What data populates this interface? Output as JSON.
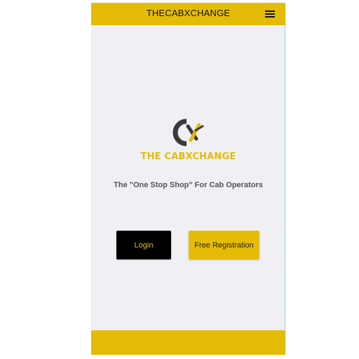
{
  "header": {
    "title": "THECABXCHANGE",
    "menu_icon": "hamburger-menu-icon"
  },
  "brand": {
    "logo_icon": "cabxchange-logo-icon",
    "name": "THE CABXCHANGE",
    "tagline": "The \"One Stop Shop\" For Cab Operators"
  },
  "actions": {
    "login_label": "Login",
    "register_label": "Free Registration"
  },
  "colors": {
    "accent": "#e4bc07",
    "background": "#f0f0f4",
    "dark": "#000000"
  }
}
